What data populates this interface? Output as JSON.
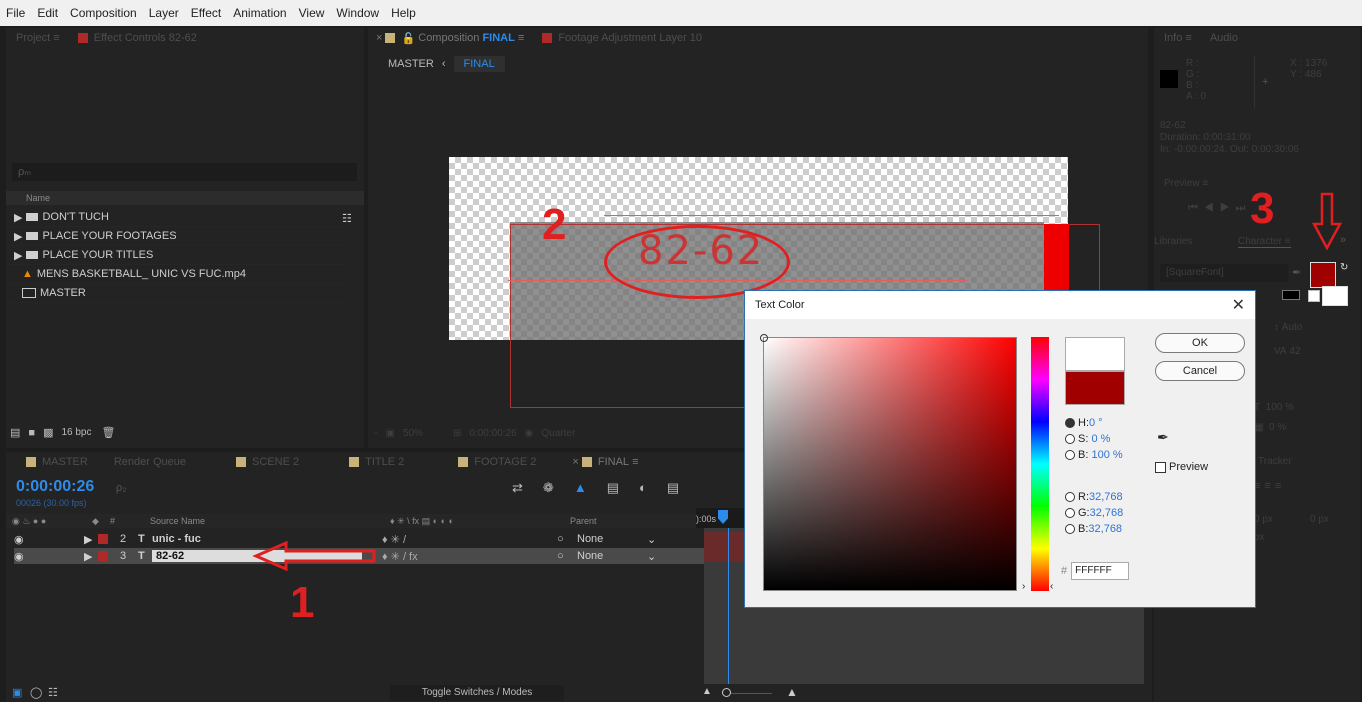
{
  "menu": [
    "File",
    "Edit",
    "Composition",
    "Layer",
    "Effect",
    "Animation",
    "View",
    "Window",
    "Help"
  ],
  "project_panel": {
    "tabs": [
      "Project",
      "Effect Controls 82-62"
    ],
    "search_placeholder": "ρₘ",
    "column_name": "Name",
    "items": [
      "DON'T TUCH",
      "PLACE YOUR FOOTAGES",
      "PLACE YOUR TITLES",
      "MENS BASKETBALL_ UNIC VS FUC.mp4",
      "MASTER"
    ],
    "bpc": "16 bpc"
  },
  "comp_panel": {
    "tab_comp_prefix": "Composition",
    "tab_comp_name": "FINAL",
    "tab_footage": "Footage Adjustment Layer 10",
    "breadcrumb_master": "MASTER",
    "breadcrumb_final": "FINAL",
    "layer_text": "82-62",
    "zoom": "50%",
    "timecode": "0:00:00:26",
    "resolution": "Quarter"
  },
  "info_panel": {
    "tabs": [
      "Info",
      "Audio"
    ],
    "r": "R :",
    "g": "G :",
    "b": "B :",
    "a": "A : 0",
    "x": "X : 1376",
    "y": "Y : 486",
    "layer_name": "82-62",
    "duration": "Duration: 0:00:31:00",
    "inout": "In: -0:00:00:24, Out: 0:00:30:06"
  },
  "right_panels": {
    "preview": "Preview",
    "libraries": "Libraries",
    "character": "Character",
    "font": "[SquareFont]",
    "leading": "Auto",
    "tracking": "42",
    "vscale": "100 %",
    "baseline": "0 %",
    "tracker": "Tracker",
    "px1": "0 px",
    "px2": "0 px",
    "px3": "px",
    "text_color": "#a00000"
  },
  "timeline": {
    "tabs": [
      "MASTER",
      "Render Queue",
      "SCENE 2",
      "TITLE 2",
      "FOOTAGE 2",
      "FINAL"
    ],
    "timecode": "0:00:00:26",
    "frames": "00026 (30.00 fps)",
    "col_source": "Source Name",
    "col_parent": "Parent",
    "col_num": "#",
    "layers": [
      {
        "num": "2",
        "name": "unic - fuc",
        "parent": "None"
      },
      {
        "num": "3",
        "name": "82-62",
        "parent": "None"
      }
    ],
    "ruler_start": "):00s",
    "toggle": "Toggle Switches / Modes"
  },
  "dialog": {
    "title": "Text Color",
    "ok": "OK",
    "cancel": "Cancel",
    "h_label": "H:",
    "h_val": "0 °",
    "s_label": "S:",
    "s_val": "0 %",
    "b_label": "B:",
    "b_val": "100 %",
    "r_label": "R:",
    "r_val": "32,768",
    "g_label": "G:",
    "g_val": "32,768",
    "bl_label": "B:",
    "bl_val": "32,768",
    "hash": "#",
    "hex": "FFFFFF",
    "preview": "Preview",
    "new_color": "#ffffff",
    "old_color": "#a00000"
  },
  "annotations": [
    "1",
    "2",
    "3"
  ],
  "colors": {
    "accent_red": "#e02020",
    "ui_blue": "#2d8ceb",
    "label_red": "#b02828"
  }
}
